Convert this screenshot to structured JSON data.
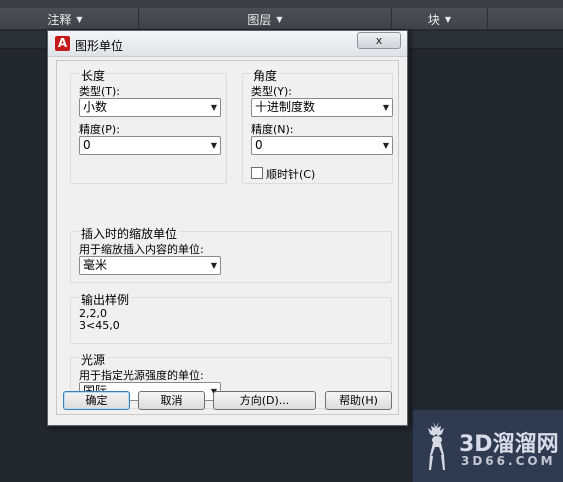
{
  "ribbon": {
    "panels": [
      "注释",
      "图层",
      "块"
    ]
  },
  "dialog": {
    "title": "图形单位",
    "close_label": "x",
    "length": {
      "group_title": "长度",
      "type_label": "类型(T):",
      "type_value": "小数",
      "precision_label": "精度(P):",
      "precision_value": "0"
    },
    "angle": {
      "group_title": "角度",
      "type_label": "类型(Y):",
      "type_value": "十进制度数",
      "precision_label": "精度(N):",
      "precision_value": "0",
      "clockwise_label": "顺时针(C)",
      "clockwise_checked": false
    },
    "insert_scale": {
      "group_title": "插入时的缩放单位",
      "label": "用于缩放插入内容的单位:",
      "value": "毫米"
    },
    "sample": {
      "group_title": "输出样例",
      "lines": [
        "2,2,0",
        "3<45,0"
      ]
    },
    "lighting": {
      "group_title": "光源",
      "label": "用于指定光源强度的单位:",
      "value": "国际"
    },
    "buttons": {
      "ok": "确定",
      "cancel": "取消",
      "direction": "方向(D)...",
      "help": "帮助(H)"
    }
  },
  "watermark": {
    "title": "3D溜溜网",
    "subtitle": "3D66.COM"
  },
  "colors": {
    "app_icon": "#c41a1a",
    "background": "#212830"
  }
}
